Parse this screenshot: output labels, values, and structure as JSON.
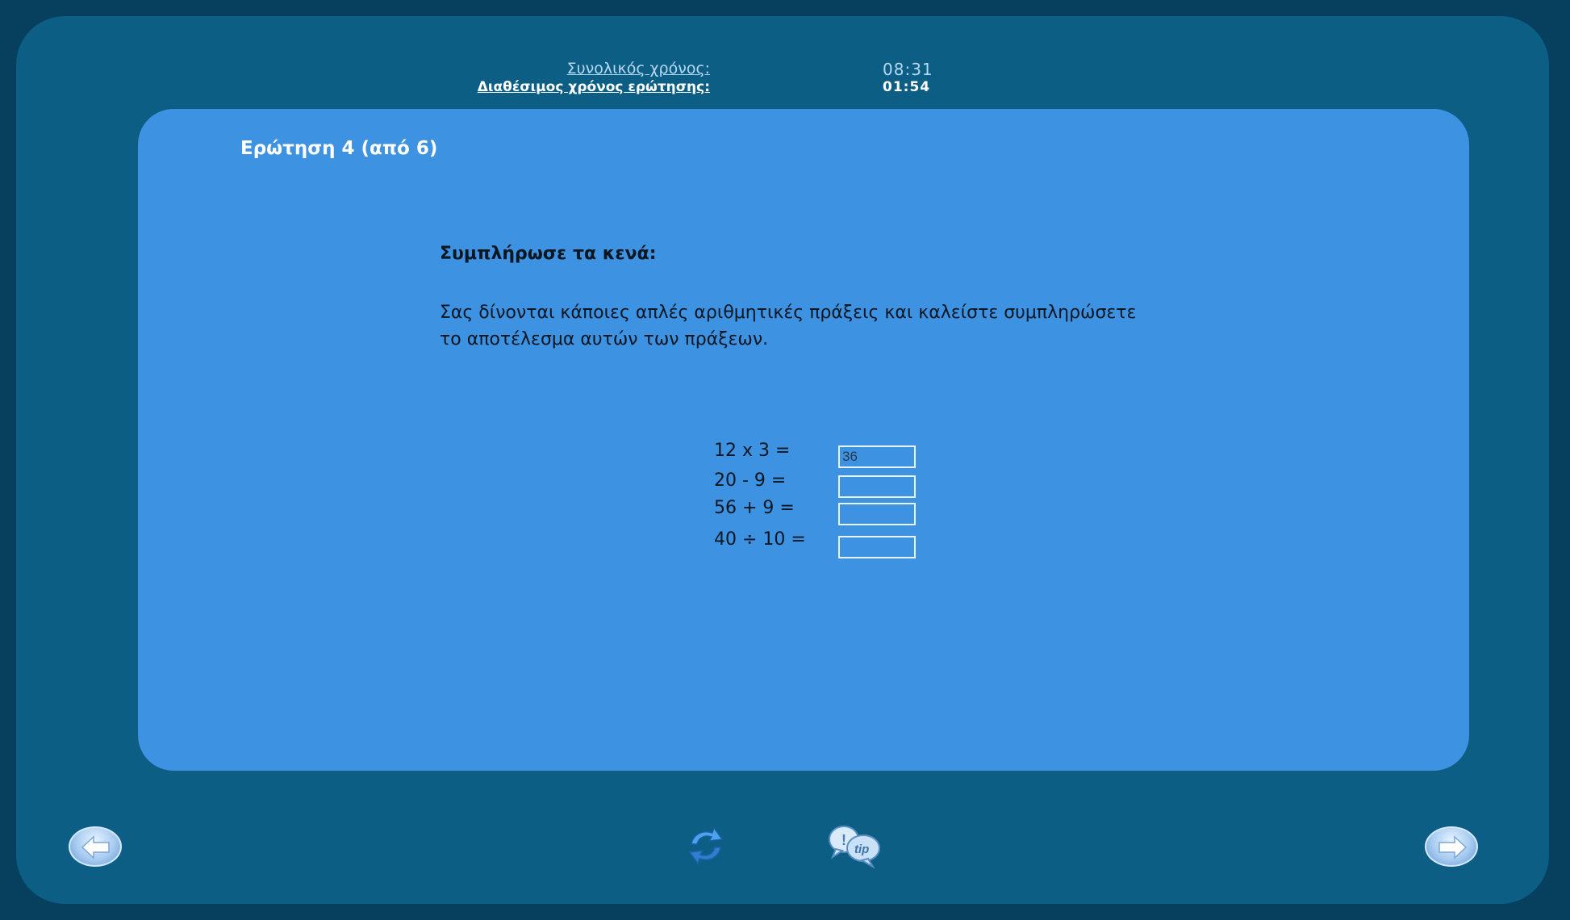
{
  "timers": {
    "total_label": "Συνολικός χρόνος:",
    "total_value": "08:31",
    "question_label": "Διαθέσιμος χρόνος ερώτησης:",
    "question_value": "01:54"
  },
  "question": {
    "title": "Ερώτηση 4 (από 6)",
    "instruction": "Συμπλήρωσε τα κενά:",
    "description_line1": "Σας δίνονται κάποιες απλές αριθμητικές πράξεις και καλείστε συμπληρώσετε",
    "description_line2": "το αποτέλεσμα αυτών των πράξεων."
  },
  "equations": [
    {
      "expr": "12 x 3 =",
      "answer": "36"
    },
    {
      "expr": "20 - 9 =",
      "answer": ""
    },
    {
      "expr": "56 + 9 =",
      "answer": ""
    },
    {
      "expr": "40 ÷ 10 =",
      "answer": ""
    }
  ],
  "tools": {
    "tip_label": "tip"
  },
  "colors": {
    "background": "#07405f",
    "frame": "#0c5e85",
    "panel": "#3d92e2"
  },
  "icons": {
    "back": "arrow-left-icon",
    "next": "arrow-right-icon",
    "refresh": "refresh-icon",
    "tip": "tip-icon"
  }
}
